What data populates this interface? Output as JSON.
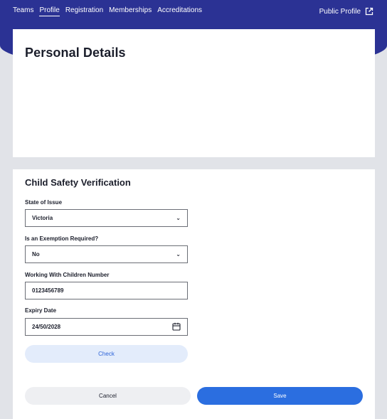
{
  "nav": {
    "items": [
      {
        "label": "Teams"
      },
      {
        "label": "Profile",
        "active": true
      },
      {
        "label": "Registration"
      },
      {
        "label": "Memberships"
      },
      {
        "label": "Accreditations"
      }
    ],
    "public_profile_label": "Public Profile"
  },
  "personal": {
    "title": "Personal Details"
  },
  "child_safety": {
    "title": "Child Safety Verification",
    "state_label": "State of Issue",
    "state_value": "Victoria",
    "exemption_label": "Is an Exemption Required?",
    "exemption_value": "No",
    "wwc_label": "Working With Children Number",
    "wwc_value": "0123456789",
    "expiry_label": "Expiry Date",
    "expiry_value": "24/50/2028",
    "check_label": "Check"
  },
  "actions": {
    "cancel_label": "Cancel",
    "save_label": "Save"
  },
  "colors": {
    "nav_bg": "#2b3294",
    "primary": "#2b6ee0",
    "check_bg": "#e3ecfb"
  }
}
